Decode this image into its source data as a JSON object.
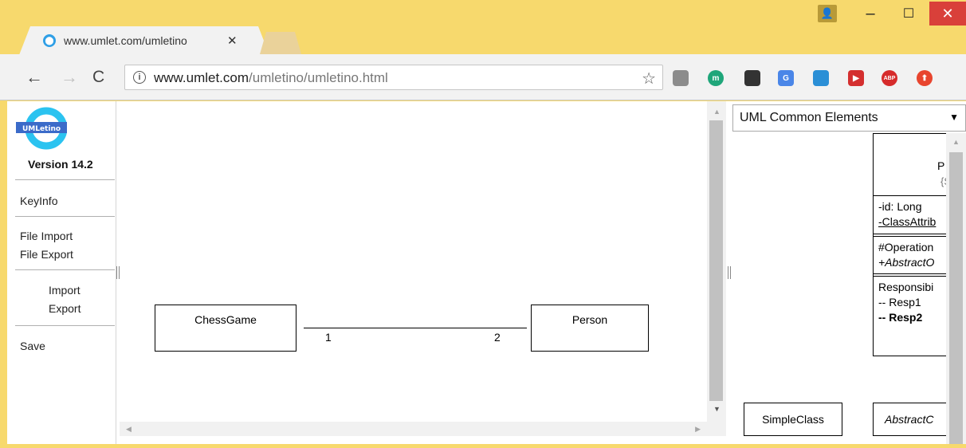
{
  "window": {
    "minimize_glyph": "–",
    "maximize_glyph": "☐",
    "close_glyph": "✕",
    "profile_glyph": "👤"
  },
  "tab": {
    "title": "www.umlet.com/umletino",
    "close_glyph": "✕"
  },
  "toolbar": {
    "back_glyph": "←",
    "forward_glyph": "→",
    "reload_glyph": "C",
    "url_host": "www.umlet.com",
    "url_path": "/umletino/umletino.html",
    "star_glyph": "☆",
    "extensions": [
      {
        "name": "film-extension-icon",
        "label": "",
        "color": "#8c8c8c"
      },
      {
        "name": "m-extension-icon",
        "label": "m",
        "color": "#1fa67a"
      },
      {
        "name": "drop-extension-icon",
        "label": "",
        "color": "#333333"
      },
      {
        "name": "translate-extension-icon",
        "label": "G",
        "color": "#4a86e8"
      },
      {
        "name": "window-extension-icon",
        "label": "",
        "color": "#2b8fd6"
      },
      {
        "name": "play-extension-icon",
        "label": "▶",
        "color": "#d42f2f"
      },
      {
        "name": "abp-extension-icon",
        "label": "ABP",
        "color": "#d62b2b"
      },
      {
        "name": "upload-extension-icon",
        "label": "⬆",
        "color": "#e8452e"
      }
    ]
  },
  "sidebar": {
    "logo_text": "UMLetino",
    "version": "Version 14.2",
    "keyinfo": "KeyInfo",
    "file_import": "File Import",
    "file_export": "File Export",
    "import": "Import",
    "export": "Export",
    "save": "Save"
  },
  "diagram": {
    "class_a": "ChessGame",
    "class_b": "Person",
    "multiplicity_a": "1",
    "multiplicity_b": "2"
  },
  "palette": {
    "selector_value": "UML Common Elements",
    "class_title": "P",
    "class_stereotype": "{S",
    "attr1": "-id: Long",
    "attr2": "-ClassAttrib",
    "op1": "#Operation",
    "op2": "+AbstractO",
    "resp_title": "Responsibi",
    "resp1": "-- Resp1",
    "resp2": "-- Resp2",
    "simple_class": "SimpleClass",
    "abstract_class": "AbstractC"
  },
  "colors": {
    "chrome_frame": "#f7d96d",
    "close_button": "#d9403a",
    "logo_ring": "#2bc3f0",
    "logo_label_bg": "#3b6bc9"
  }
}
